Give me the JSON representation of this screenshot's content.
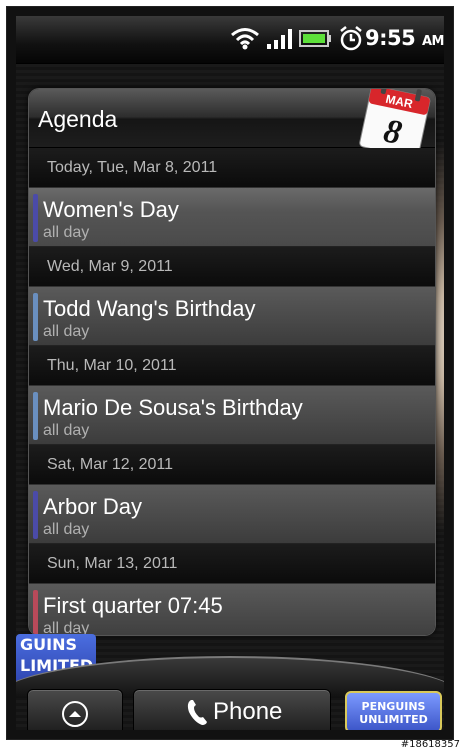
{
  "status_bar": {
    "time": "9:55",
    "ampm": "AM",
    "icons": [
      "wifi-icon",
      "signal-icon",
      "battery-icon",
      "alarm-icon"
    ]
  },
  "widget": {
    "title": "Agenda",
    "calendar_icon": {
      "month": "MAR",
      "day": "8"
    },
    "groups": [
      {
        "date": "Today, Tue, Mar 8, 2011",
        "event": "Women's Day",
        "sub": "all day",
        "color": "#4b4ba8"
      },
      {
        "date": "Wed, Mar 9, 2011",
        "event": "Todd Wang's Birthday",
        "sub": "all day",
        "color": "#6a8fbf"
      },
      {
        "date": "Thu, Mar 10, 2011",
        "event": "Mario De Sousa's Birthday",
        "sub": "all day",
        "color": "#6a8fbf"
      },
      {
        "date": "Sat, Mar 12, 2011",
        "event": "Arbor Day",
        "sub": "all day",
        "color": "#4b4ba8"
      },
      {
        "date": "Sun, Mar 13, 2011",
        "event": "First quarter 07:45",
        "sub": "all day",
        "color": "#b84a5a"
      }
    ]
  },
  "dock": {
    "phone_label": "Phone",
    "left_logo": "GUINS LIMITED",
    "right_logo_line1": "PENGUINS",
    "right_logo_line2": "UNLIMITED"
  },
  "watermark": "#18618357"
}
